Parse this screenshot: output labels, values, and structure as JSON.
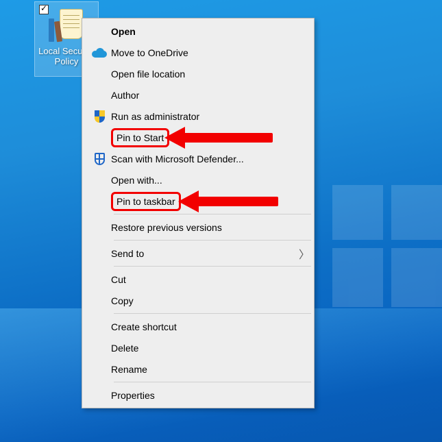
{
  "desktop_icon": {
    "label_line1": "Local Security",
    "label_line2": "Policy"
  },
  "context_menu": {
    "open": "Open",
    "move_to_onedrive": "Move to OneDrive",
    "open_file_location": "Open file location",
    "author": "Author",
    "run_as_admin": "Run as administrator",
    "pin_to_start": "Pin to Start",
    "scan_defender": "Scan with Microsoft Defender...",
    "open_with": "Open with...",
    "pin_to_taskbar": "Pin to taskbar",
    "restore_versions": "Restore previous versions",
    "send_to": "Send to",
    "cut": "Cut",
    "copy": "Copy",
    "create_shortcut": "Create shortcut",
    "delete": "Delete",
    "rename": "Rename",
    "properties": "Properties"
  },
  "annotation": {
    "highlight1": "pin_to_start",
    "highlight2": "pin_to_taskbar"
  }
}
